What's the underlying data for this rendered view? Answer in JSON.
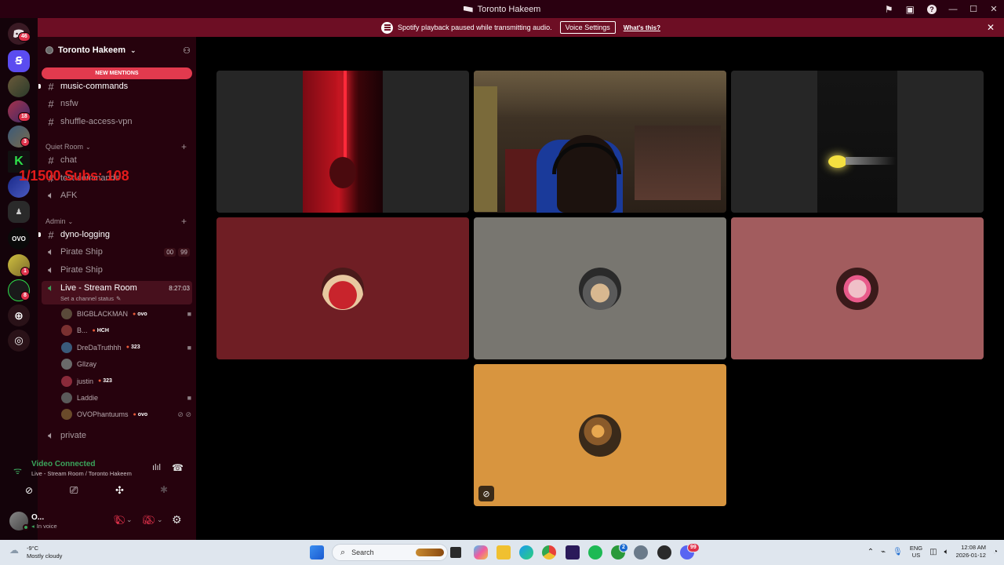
{
  "window": {
    "title": "Toronto Hakeem"
  },
  "notice": {
    "message": "Spotify playback paused while transmitting audio.",
    "voice_settings": "Voice Settings",
    "whats_this": "What's this?"
  },
  "rail": {
    "home_badge": "46",
    "badge_18": "18",
    "badge_3": "3",
    "badge_1": "1",
    "badge_8": "8",
    "ovo": "OVO"
  },
  "guild": {
    "name": "Toronto Hakeem",
    "new_mentions": "NEW MENTIONS"
  },
  "channels": {
    "music_commands": "music-commands",
    "nsfw": "nsfw",
    "shuffle_access": "shuffle-access-vpn",
    "quiet_room": "Quiet Room",
    "chat": "chat",
    "test_commands": "test-commands",
    "afk": "AFK",
    "admin": "Admin",
    "dyno_logging": "dyno-logging",
    "pirate_ship_1": "Pirate Ship",
    "pirate_ship_1_left": "00",
    "pirate_ship_1_right": "99",
    "pirate_ship_2": "Pirate Ship",
    "live_stream_room": "Live - Stream Room",
    "live_timer": "8:27:03",
    "channel_status": "Set a channel status",
    "private": "private"
  },
  "overlay": {
    "text": "1/1500 Subs: 108"
  },
  "members": [
    {
      "name": "BIGBLACKMAN",
      "tag": "ovo",
      "color": "#5a4a3a"
    },
    {
      "name": "B...",
      "tag": "HCH",
      "color": "#7a3030"
    },
    {
      "name": "DreDaTruthhh",
      "tag": "323",
      "color": "#3a5a7a"
    },
    {
      "name": "Gllzay",
      "tag": "",
      "color": "#6a6a6a"
    },
    {
      "name": "justin",
      "tag": "323",
      "color": "#8a2a3a"
    },
    {
      "name": "Laddie",
      "tag": "",
      "color": "#5a5a5a"
    },
    {
      "name": "OVOPhantuums",
      "tag": "ovo",
      "color": "#6a4a2a"
    }
  ],
  "voice": {
    "status": "Video Connected",
    "location": "Live - Stream Room / Toronto Hakeem"
  },
  "user": {
    "name": "O...",
    "status": "In voice"
  },
  "colors": {
    "tile_red": "#6f1e24",
    "tile_gray": "#787670",
    "tile_pink": "#a25c5e",
    "tile_orange": "#d8953f",
    "tile_dark": "#262626"
  },
  "taskbar": {
    "temperature": "-9°C",
    "weather": "Mostly cloudy",
    "search_placeholder": "Search",
    "lang1": "ENG",
    "lang2": "US",
    "time": "12:08 AM",
    "date": "2026-01-12",
    "store_badge": "2",
    "discord_badge": "99"
  }
}
